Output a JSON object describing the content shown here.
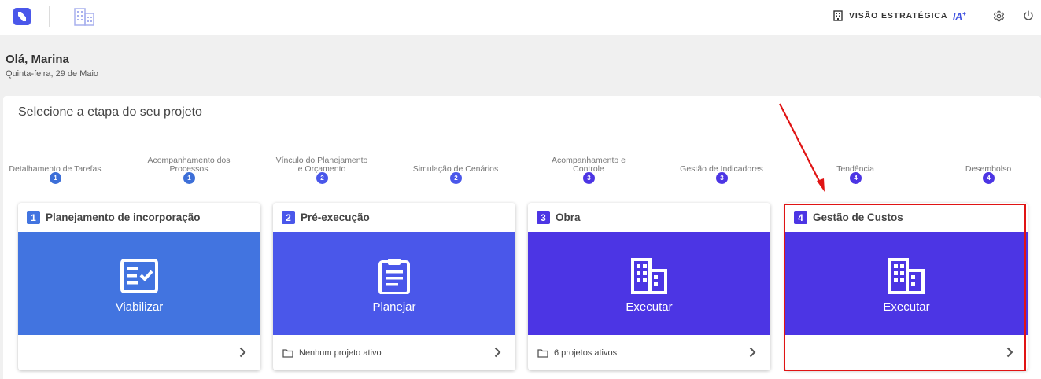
{
  "topbar": {
    "strategic_view_label": "VISÃO ESTRATÉGICA",
    "ia_label": "IA",
    "ia_sup": "+",
    "icons": [
      "logo-icon",
      "building-icon",
      "building-icon",
      "gear-icon",
      "power-icon"
    ]
  },
  "header": {
    "greeting": "Olá, Marina",
    "date": "Quinta-feira, 29 de Maio"
  },
  "main": {
    "title": "Selecione a etapa do seu projeto",
    "steps": [
      {
        "label": "Detalhamento de Tarefas",
        "num": "1"
      },
      {
        "label": "Acompanhamento dos Processos",
        "num": "1"
      },
      {
        "label": "Vínculo do Planejamento e Orçamento",
        "num": "2"
      },
      {
        "label": "Simulação de Cenários",
        "num": "2"
      },
      {
        "label": "Acompanhamento e Controle",
        "num": "3"
      },
      {
        "label": "Gestão de Indicadores",
        "num": "3"
      },
      {
        "label": "Tendência",
        "num": "4"
      },
      {
        "label": "Desembolso",
        "num": "4"
      }
    ],
    "cards": [
      {
        "num": "1",
        "title": "Planejamento de incorporação",
        "action": "Viabilizar",
        "footer": "",
        "icon": "checklist-icon"
      },
      {
        "num": "2",
        "title": "Pré-execução",
        "action": "Planejar",
        "footer": "Nenhum projeto ativo",
        "icon": "clipboard-icon"
      },
      {
        "num": "3",
        "title": "Obra",
        "action": "Executar",
        "footer": "6 projetos ativos",
        "icon": "building-icon"
      },
      {
        "num": "4",
        "title": "Gestão de Custos",
        "action": "Executar",
        "footer": "",
        "icon": "building-icon"
      }
    ]
  },
  "colors": {
    "stage1": "#4274e0",
    "stage2": "#4a57ea",
    "stage3": "#4c35e4",
    "stage4": "#4c35e4",
    "highlight": "#e01414",
    "dot1": "#3d6fd8",
    "dot2": "#4a57ea",
    "dot3": "#4c35e4"
  }
}
